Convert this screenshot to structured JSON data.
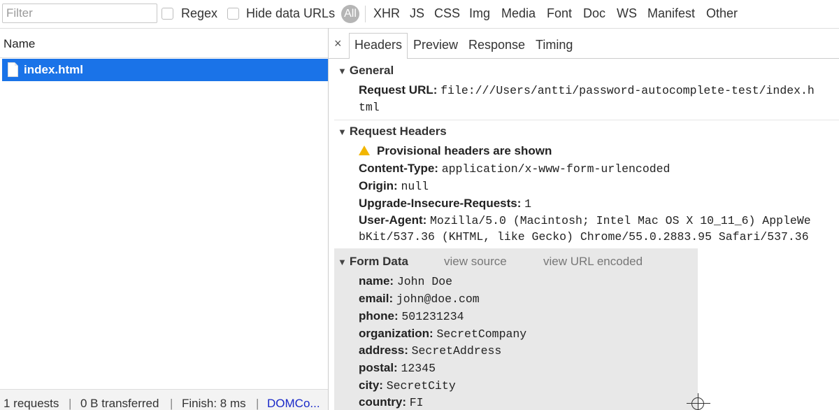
{
  "toolbar": {
    "filter_placeholder": "Filter",
    "regex_label": "Regex",
    "hide_data_urls_label": "Hide data URLs",
    "types": [
      "All",
      "XHR",
      "JS",
      "CSS",
      "Img",
      "Media",
      "Font",
      "Doc",
      "WS",
      "Manifest",
      "Other"
    ]
  },
  "request_list": {
    "column_name": "Name",
    "rows": [
      {
        "name": "index.html",
        "selected": true
      }
    ]
  },
  "status_bar": {
    "requests": "1 requests",
    "transferred": "0 B transferred",
    "finish": "Finish: 8 ms",
    "domcontent": "DOMCo..."
  },
  "detail_tabs": {
    "close": "×",
    "tabs": [
      "Headers",
      "Preview",
      "Response",
      "Timing"
    ],
    "active": "Headers"
  },
  "general": {
    "title": "General",
    "request_url_key": "Request URL:",
    "request_url_line1": "file:///Users/antti/password-autocomplete-test/index.h",
    "request_url_line2": "tml"
  },
  "request_headers": {
    "title": "Request Headers",
    "warning": "Provisional headers are shown",
    "content_type_key": "Content-Type:",
    "content_type_val": "application/x-www-form-urlencoded",
    "origin_key": "Origin:",
    "origin_val": "null",
    "upgrade_key": "Upgrade-Insecure-Requests:",
    "upgrade_val": "1",
    "user_agent_key": "User-Agent:",
    "user_agent_line1": "Mozilla/5.0 (Macintosh; Intel Mac OS X 10_11_6) AppleWe",
    "user_agent_line2": "bKit/537.36 (KHTML, like Gecko) Chrome/55.0.2883.95 Safari/537.36"
  },
  "form_data": {
    "title": "Form Data",
    "view_source": "view source",
    "view_url_encoded": "view URL encoded",
    "fields": [
      {
        "key": "name:",
        "value": "John Doe"
      },
      {
        "key": "email:",
        "value": "john@doe.com"
      },
      {
        "key": "phone:",
        "value": "501231234"
      },
      {
        "key": "organization:",
        "value": "SecretCompany"
      },
      {
        "key": "address:",
        "value": "SecretAddress"
      },
      {
        "key": "postal:",
        "value": "12345"
      },
      {
        "key": "city:",
        "value": "SecretCity"
      },
      {
        "key": "country:",
        "value": "FI"
      }
    ]
  },
  "colors": {
    "selection": "#1a73e8",
    "warning": "#f2b600",
    "form_data_bg": "#e8e8e8"
  }
}
